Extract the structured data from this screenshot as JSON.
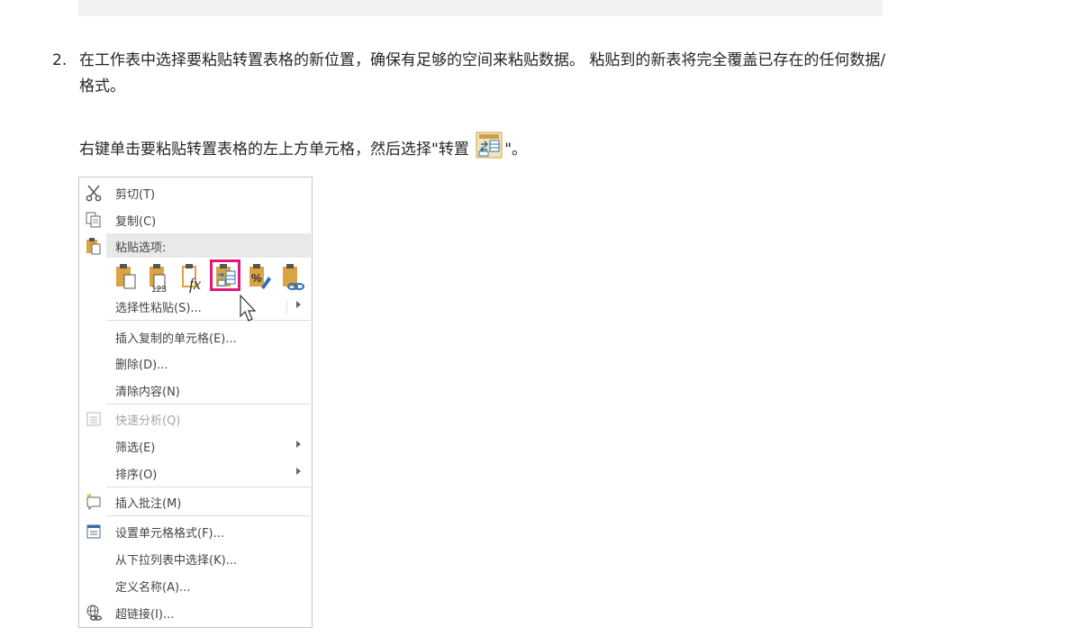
{
  "step": {
    "number": "2.",
    "text": "在工作表中选择要粘贴转置表格的新位置，确保有足够的空间来粘贴数据。 粘贴到的新表将完全覆盖已存在的任何数据/格式。"
  },
  "instruction": {
    "before": "右键单击要粘贴转置表格的左上方单元格，然后选择\"转置 ",
    "after": "\"。"
  },
  "menu": {
    "cut": "剪切(T)",
    "copy": "复制(C)",
    "paste_options": "粘贴选项:",
    "paste_special": "选择性粘贴(S)...",
    "insert_copied": "插入复制的单元格(E)...",
    "delete": "删除(D)...",
    "clear": "清除内容(N)",
    "quick_analysis": "快速分析(Q)",
    "filter": "筛选(E)",
    "sort": "排序(O)",
    "insert_comment": "插入批注(M)",
    "format_cells": "设置单元格格式(F)...",
    "pick_from_list": "从下拉列表中选择(K)...",
    "define_name": "定义名称(A)...",
    "hyperlink": "超链接(I)..."
  },
  "colors": {
    "highlight": "#e0187a",
    "clipboard": "#d9a441"
  },
  "icons": [
    "scissors-icon",
    "copy-icon",
    "paste-icon",
    "quick-analysis-icon",
    "comment-icon",
    "format-cells-icon",
    "hyperlink-icon",
    "transpose-icon"
  ]
}
